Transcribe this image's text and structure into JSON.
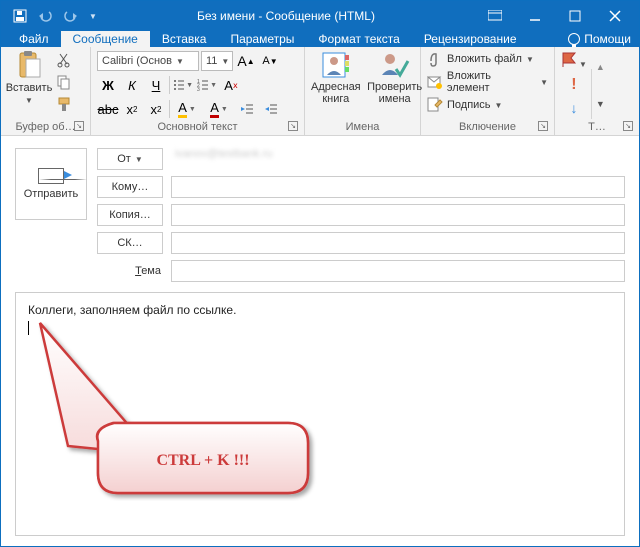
{
  "window": {
    "title": "Без имени - Сообщение (HTML)"
  },
  "tabs": {
    "file": "Файл",
    "message": "Сообщение",
    "insert": "Вставка",
    "options": "Параметры",
    "format": "Формат текста",
    "review": "Рецензирование",
    "help": "Помощи"
  },
  "ribbon": {
    "clipboard": {
      "paste": "Вставить",
      "label": "Буфер об…"
    },
    "font": {
      "name": "Calibri (Основ",
      "size": "11",
      "label": "Основной текст",
      "bold": "Ж",
      "italic": "К",
      "underline": "Ч",
      "sub": "x",
      "sup": "x",
      "hl": "А",
      "color": "А"
    },
    "names": {
      "addressbook": "Адресная книга",
      "checknames": "Проверить имена",
      "label": "Имена"
    },
    "include": {
      "attachfile": "Вложить файл",
      "attachitem": "Вложить элемент",
      "signature": "Подпись",
      "label": "Включение"
    },
    "tags": {
      "label": "Т…"
    }
  },
  "compose": {
    "send": "Отправить",
    "from": "От",
    "from_value": "ivanov@testbank.ru",
    "to": "Кому…",
    "cc": "Копия…",
    "bcc": "СК…",
    "subject": "Тема"
  },
  "body": {
    "text": "Коллеги, заполняем файл по ссылке."
  },
  "annotation": {
    "text": "CTRL + K !!!"
  }
}
